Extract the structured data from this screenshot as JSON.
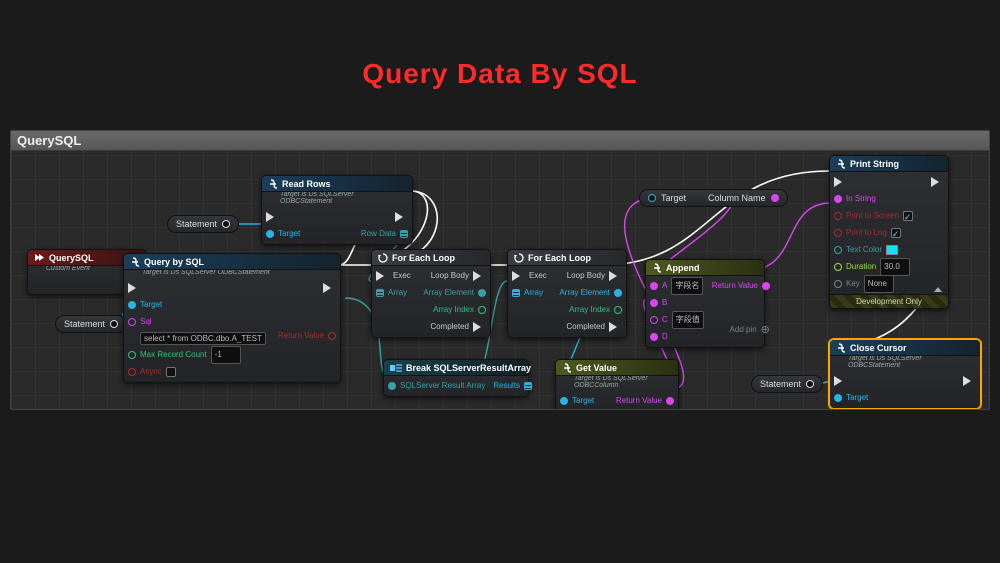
{
  "page_title": "Query Data By SQL",
  "panel_title": "QuerySQL",
  "pills": {
    "statement1": "Statement",
    "statement2": "Statement",
    "statement3": "Statement",
    "target1": "Target",
    "column_name": "Column Name"
  },
  "nodes": {
    "querysql_event": {
      "title": "QuerySQL",
      "subtitle": "Custom Event",
      "icon": "chevrons"
    },
    "query_by_sql": {
      "title": "Query by SQL",
      "subtitle": "Target is Ds SQLServer ODBCStatement",
      "pins": {
        "exec_in": "",
        "target": "Target",
        "sql": "Sql",
        "sql_value": "select * from ODBC.dbo.A_TEST",
        "max_record": "Max Record Count",
        "max_record_value": "-1",
        "async": "Async",
        "exec_out": "",
        "return_value": "Return Value"
      }
    },
    "read_rows": {
      "title": "Read Rows",
      "subtitle": "Target is Ds SQLServer ODBCStatement",
      "pins": {
        "exec_in": "",
        "target": "Target",
        "exec_out": "",
        "rowdata": "Row Data"
      }
    },
    "for_each1": {
      "title": "For Each Loop",
      "pins": {
        "exec": "Exec",
        "array": "Array",
        "loop_body": "Loop Body",
        "array_elem": "Array Element",
        "array_idx": "Array Index",
        "completed": "Completed"
      }
    },
    "break_result": {
      "title": "Break SQLServerResultArray",
      "pins": {
        "in": "SQLServer Result Array",
        "out": "Results"
      }
    },
    "for_each2": {
      "title": "For Each Loop",
      "pins": {
        "exec": "Exec",
        "array": "Array",
        "loop_body": "Loop Body",
        "array_elem": "Array Element",
        "array_idx": "Array Index",
        "completed": "Completed"
      }
    },
    "get_value": {
      "title": "Get Value",
      "subtitle": "Target is Ds SQLServer ODBCColumn",
      "pins": {
        "target": "Target",
        "return_value": "Return Value"
      }
    },
    "append": {
      "title": "Append",
      "pins": {
        "a": "A",
        "a_value": "字段名",
        "b": "B",
        "c": "C",
        "c_value": "字段值",
        "d": "D",
        "return_value": "Return Value",
        "add_pin": "Add pin"
      }
    },
    "print_string": {
      "title": "Print String",
      "pins": {
        "exec_in": "",
        "exec_out": "",
        "in_string": "In String",
        "print_screen": "Print to Screen",
        "print_log": "Print to Log",
        "text_color": "Text Color",
        "duration": "Duration",
        "duration_value": "30.0",
        "key": "Key",
        "key_value": "None"
      },
      "dev_only": "Development Only",
      "swatch_color": "#00e5ff"
    },
    "close_cursor": {
      "title": "Close Cursor",
      "subtitle": "Target is Ds SQLServer ODBCStatement",
      "pins": {
        "exec_in": "",
        "exec_out": "",
        "target": "Target"
      }
    }
  }
}
